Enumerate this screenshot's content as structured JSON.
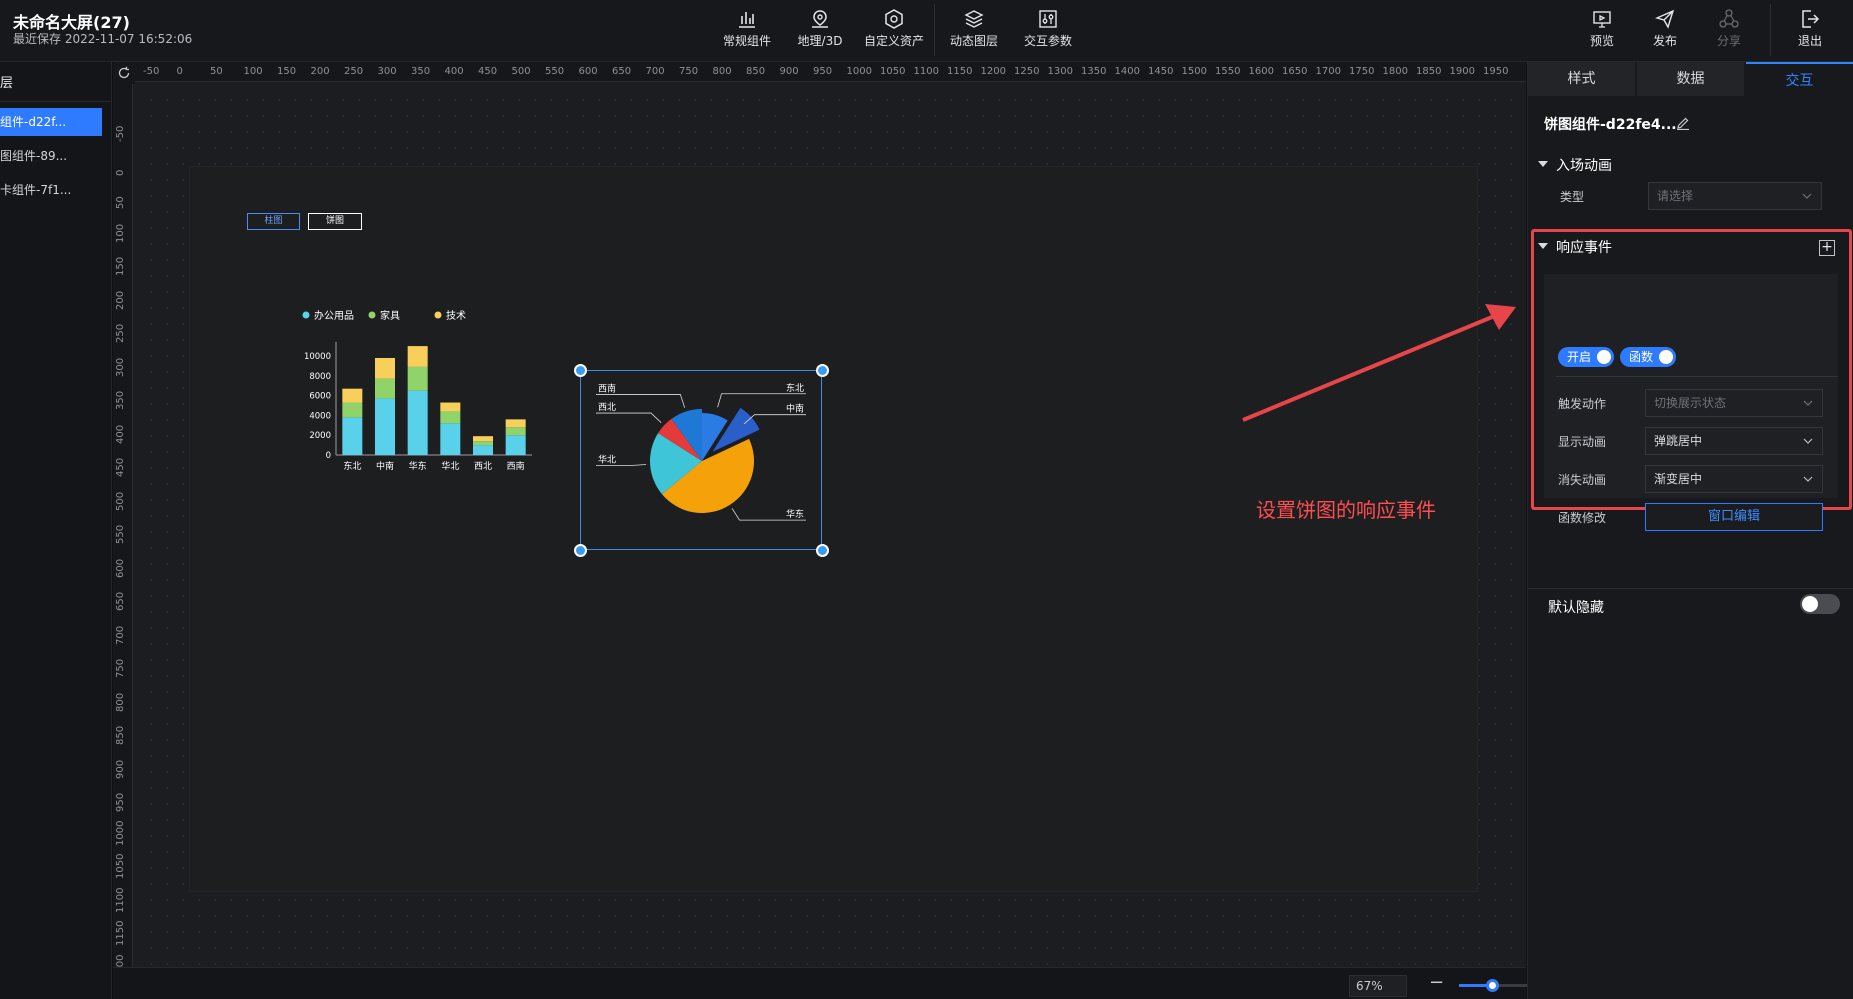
{
  "header": {
    "title": "未命名大屏(27)",
    "save_time": "最近保存 2022-11-07 16:52:06",
    "tools": [
      {
        "label": "常规组件",
        "icon": "bar-chart-icon"
      },
      {
        "label": "地理/3D",
        "icon": "map-pin-icon"
      },
      {
        "label": "自定义资产",
        "icon": "hexagon-icon"
      },
      {
        "label": "动态图层",
        "icon": "layers-icon"
      },
      {
        "label": "交互参数",
        "icon": "sliders-icon"
      }
    ],
    "actions": [
      {
        "label": "预览",
        "icon": "monitor-icon"
      },
      {
        "label": "发布",
        "icon": "send-icon"
      },
      {
        "label": "分享",
        "icon": "share-icon"
      },
      {
        "label": "退出",
        "icon": "exit-icon"
      }
    ]
  },
  "layers": {
    "header": "层",
    "items": [
      "组件-d22f...",
      "图组件-89...",
      "卡组件-7f1..."
    ]
  },
  "rulers": {
    "top": [
      "-50",
      "0",
      "50",
      "100",
      "150",
      "200",
      "250",
      "300",
      "350",
      "400",
      "450",
      "500",
      "550",
      "600",
      "650",
      "700",
      "750",
      "800",
      "850",
      "900",
      "950",
      "1000",
      "1050",
      "1100",
      "1150",
      "1200",
      "1250",
      "1300",
      "1350",
      "1400",
      "1450",
      "1500",
      "1550",
      "1600",
      "1650",
      "1700",
      "1750",
      "1800",
      "1850",
      "1900",
      "1950"
    ],
    "left": [
      "-50",
      "0",
      "50",
      "100",
      "150",
      "200",
      "250",
      "300",
      "350",
      "400",
      "450",
      "500",
      "550",
      "600",
      "650",
      "700",
      "750",
      "800",
      "850",
      "900",
      "950",
      "1000",
      "1050",
      "1100",
      "1150",
      "1200"
    ]
  },
  "screen": {
    "switch_buttons": [
      "柱图",
      "饼图"
    ],
    "active_switch": 1
  },
  "chart_data": [
    {
      "type": "bar",
      "stacked": true,
      "categories": [
        "东北",
        "中南",
        "华东",
        "华北",
        "西北",
        "西南"
      ],
      "series": [
        {
          "name": "办公用品",
          "color": "#5ad1ea",
          "values": [
            3800,
            5700,
            6500,
            3200,
            1000,
            2000
          ]
        },
        {
          "name": "家具",
          "color": "#8fd369",
          "values": [
            1500,
            2000,
            2400,
            1200,
            400,
            800
          ]
        },
        {
          "name": "技术",
          "color": "#f7cf5a",
          "values": [
            1400,
            2100,
            2100,
            900,
            500,
            800
          ]
        }
      ],
      "y_ticks": [
        "10000",
        "8000",
        "6000",
        "4000",
        "2000",
        "0"
      ],
      "ylim": [
        0,
        10000
      ]
    },
    {
      "type": "pie",
      "categories": [
        "东北",
        "中南",
        "华东",
        "华北",
        "西北",
        "西南"
      ],
      "values": [
        9,
        9,
        46,
        20,
        6,
        10
      ],
      "colors": [
        "#2a7be4",
        "#2a5fc9",
        "#f5a20a",
        "#3ec5d8",
        "#e53a3a",
        "#1f78d6"
      ],
      "exploded": "中南"
    }
  ],
  "annotation": {
    "text": "设置饼图的响应事件"
  },
  "zoom": {
    "value": "67%",
    "level": 0.33
  },
  "right_panel": {
    "tabs": [
      "样式",
      "数据",
      "交互"
    ],
    "active_tab": 2,
    "component_name": "饼图组件-d22fe4...",
    "entry_anim": {
      "title": "入场动画",
      "type_label": "类型",
      "type_placeholder": "请选择"
    },
    "events": {
      "title": "响应事件",
      "toggle_enable": "开启",
      "toggle_func": "函数",
      "trigger_label": "触发动作",
      "trigger_value": "切换展示状态",
      "show_anim_label": "显示动画",
      "show_anim_value": "弹跳居中",
      "hide_anim_label": "消失动画",
      "hide_anim_value": "渐变居中",
      "func_label": "函数修改",
      "func_button": "窗口编辑"
    },
    "default_hidden_label": "默认隐藏",
    "default_hidden": false
  }
}
